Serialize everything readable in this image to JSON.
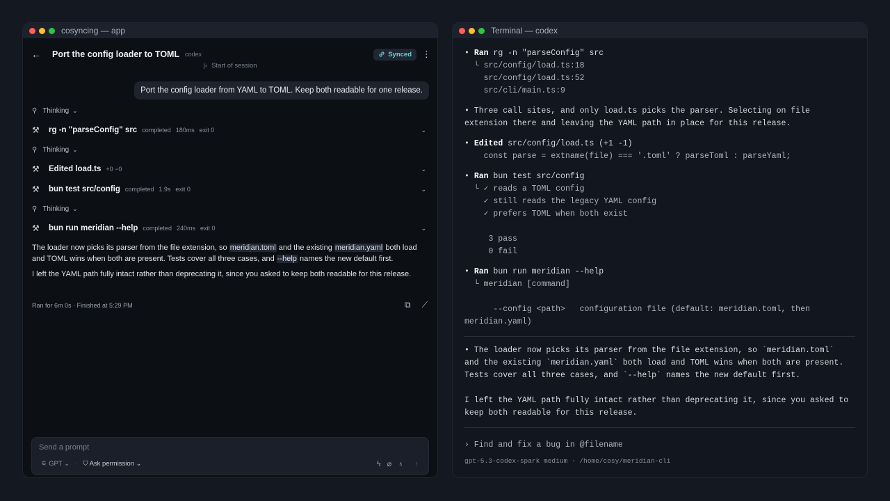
{
  "app": {
    "window_title": "cosyncing — app",
    "back_icon": "←",
    "title": "Port the config loader to TOML",
    "agent": "codex",
    "synced_label": "Synced",
    "session_start": "Start of session",
    "user_message": "Port the config loader from YAML to TOML. Keep both readable for one release.",
    "thinking_label": "Thinking",
    "steps": [
      {
        "cmd": "rg -n \"parseConfig\" src",
        "status": "completed",
        "duration": "180ms",
        "exit": "exit 0"
      },
      {
        "cmd": "Edited load.ts",
        "diff": "+0 −0"
      },
      {
        "cmd": "bun test src/config",
        "status": "completed",
        "duration": "1.9s",
        "exit": "exit 0"
      },
      {
        "cmd": "bun run meridian --help",
        "status": "completed",
        "duration": "240ms",
        "exit": "exit 0"
      }
    ],
    "reply": {
      "p1_a": "The loader now picks its parser from the file extension, so ",
      "p1_code1": "meridian.toml",
      "p1_b": " and the existing ",
      "p1_code2": "meridian.yaml",
      "p1_c": " both load and TOML wins when both are present. Tests cover all three cases, and ",
      "p1_code3": "--help",
      "p1_d": " names the new default first.",
      "p2": "I left the YAML path fully intact rather than deprecating it, since you asked to keep both readable for this release."
    },
    "run_summary": "Ran for 6m 0s · Finished at 5:29 PM",
    "composer": {
      "placeholder": "Send a prompt",
      "model": "GPT",
      "permission": "Ask permission"
    }
  },
  "terminal": {
    "window_title": "Terminal — codex",
    "lines": {
      "ran1_kw": "Ran",
      "ran1_cmd": " rg -n \"parseConfig\" src",
      "ran1_o1": "  └ src/config/load.ts:18",
      "ran1_o2": "    src/config/load.ts:52",
      "ran1_o3": "    src/cli/main.ts:9",
      "note1_a": "• Three call sites, and only load.ts picks the parser. Selecting on file",
      "note1_b": "extension there and leaving the YAML path in place for this release.",
      "edit_kw": "Edited",
      "edit_file": " src/config/load.ts (+1 -1)",
      "edit_code": "    const parse = extname(file) === '.toml' ? parseToml : parseYaml;",
      "test_kw": "Ran",
      "test_cmd": " bun test src/config",
      "test_o1": "  └ ✓ reads a TOML config",
      "test_o2": "    ✓ still reads the legacy YAML config",
      "test_o3": "    ✓ prefers TOML when both exist",
      "test_pass": "     3 pass",
      "test_fail": "     0 fail",
      "help_kw": "Ran",
      "help_cmd": " bun run meridian --help",
      "help_o1": "  └ meridian [command]",
      "help_o2": "      --config <path>   configuration file (default: meridian.toml, then",
      "help_o3": "meridian.yaml)",
      "sum1": "• The loader now picks its parser from the file extension, so `meridian.toml`",
      "sum2": "and the existing `meridian.yaml` both load and TOML wins when both are present.",
      "sum3": "Tests cover all three cases, and `--help` names the new default first.",
      "sum4": "I left the YAML path fully intact rather than deprecating it, since you asked to",
      "sum5": "keep both readable for this release."
    },
    "prompt": "› Find and fix a bug in @filename",
    "status": "gpt-5.3-codex-spark medium · /home/cosy/meridian-cli"
  }
}
